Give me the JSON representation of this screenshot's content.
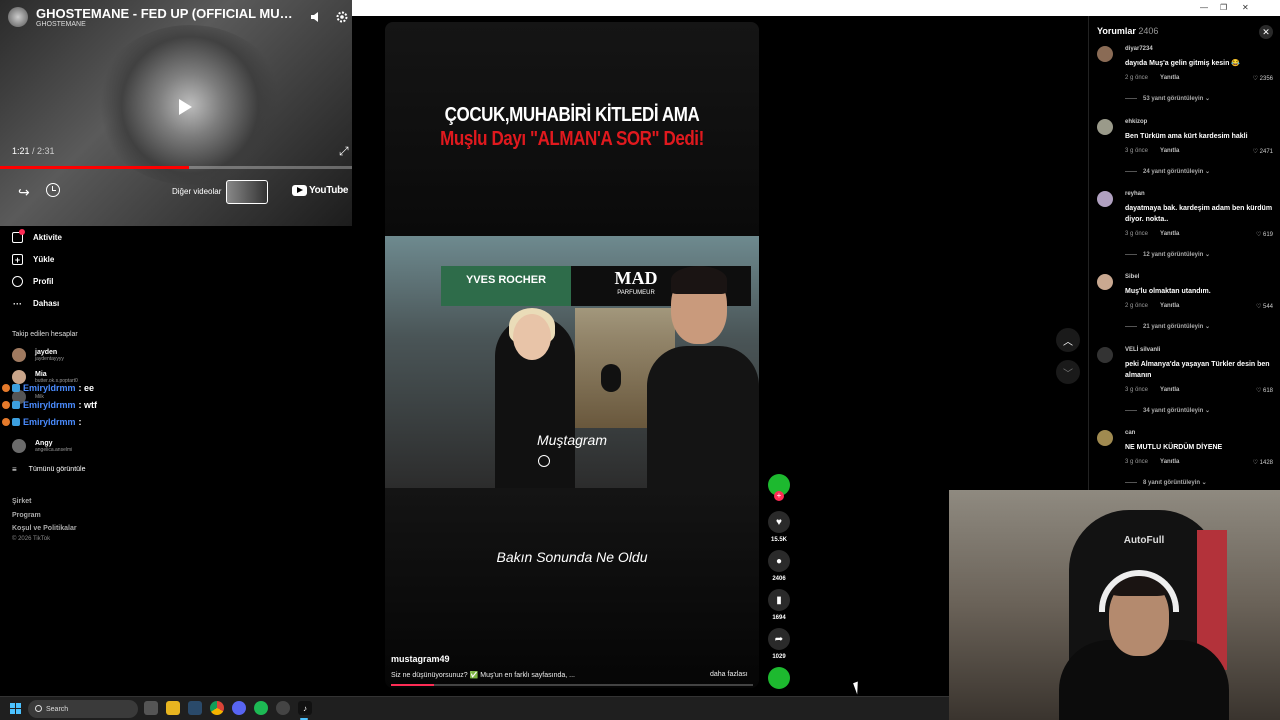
{
  "youtube_player": {
    "title": "GHOSTEMANE - FED UP (OFFICIAL MUSIC VIDEO)",
    "channel": "GHOSTEMANE",
    "current_time": "1:21",
    "duration": "/ 2:31",
    "progress": 0.536,
    "more_videos_label": "Diğer videolar",
    "logo_text": "YouTube"
  },
  "sidebar": {
    "nav": [
      {
        "label": "Aktivite",
        "icon": "inbox-icon"
      },
      {
        "label": "Yükle",
        "icon": "upload-icon"
      },
      {
        "label": "Profil",
        "icon": "profile-icon"
      },
      {
        "label": "Dahası",
        "icon": "more-icon"
      }
    ],
    "following_header": "Takip edilen hesaplar",
    "accounts": [
      {
        "name": "jayden",
        "handle": "jaydentayyyy"
      },
      {
        "name": "Mia",
        "handle": "butter.ok.s.poptart0"
      },
      {
        "name": "Milk",
        "handle": ""
      },
      {
        "name": "Angy",
        "handle": "angelica.anselmi"
      }
    ],
    "chat": [
      {
        "user": "Emiryldrmm",
        "text": ": ee"
      },
      {
        "user": "Emiryldrmm",
        "text": ": wtf"
      },
      {
        "user": "Emiryldrmm",
        "text": ":"
      }
    ],
    "show_all": "Tümünü görüntüle",
    "footer": [
      "Şirket",
      "Program",
      "Koşul ve Politikalar"
    ],
    "copyright": "© 2026 TikTok"
  },
  "video": {
    "headline_line1": "ÇOCUK,MUHABİRİ KİTLEDİ AMA",
    "headline_line2": "Muşlu Dayı \"ALMAN'A SOR\" Dedi!",
    "store_left": "YVES ROCHER",
    "store_right": "MAD",
    "store_right_sub": "PARFUMEUR",
    "watermark": "Muştagram",
    "bottom_caption": "Bakın Sonunda Ne Oldu",
    "author": "mustagram49",
    "description": "Siz ne düşünüyorsunuz? ✅ Muş'un en farklı sayfasında, ...",
    "more_label": "daha fazlası",
    "progress": 0.12
  },
  "actions": {
    "likes": "15.5K",
    "comments": "2406",
    "saves": "1694",
    "shares": "1029"
  },
  "comments_panel": {
    "title": "Yorumlar",
    "count": "2406",
    "reply_label": "Yanıtla",
    "items": [
      {
        "user": "diyar7234",
        "text": "dayıda Muş'a gelin gitmiş kesin 😂",
        "time": "2 g önce",
        "likes": "2356",
        "replies": "53 yanıt görüntüleyin"
      },
      {
        "user": "ehkizop",
        "text": "Ben Türküm ama kürt kardesim hakli",
        "time": "3 g önce",
        "likes": "2471",
        "replies": "24 yanıt görüntüleyin"
      },
      {
        "user": "reyhan",
        "text": "dayatmaya bak. kardeşim adam ben kürdüm diyor. nokta..",
        "time": "3 g önce",
        "likes": "619",
        "replies": "12 yanıt görüntüleyin"
      },
      {
        "user": "Sibel",
        "text": "Muş'lu olmaktan utandım.",
        "time": "2 g önce",
        "likes": "544",
        "replies": "21 yanıt görüntüleyin"
      },
      {
        "user": "VELİ silvanli",
        "text": "peki Almanya'da yaşayan Türkler desin ben almanın",
        "time": "3 g önce",
        "likes": "618",
        "replies": "34 yanıt görüntüleyin"
      },
      {
        "user": "can",
        "text": "NE MUTLU KÜRDÜM DİYENE",
        "time": "3 g önce",
        "likes": "1428",
        "replies": "8 yanıt görüntüleyin"
      }
    ]
  },
  "webcam": {
    "chair_text": "AutoFull"
  },
  "taskbar": {
    "search_placeholder": "Search"
  },
  "colors": {
    "tiktok_red": "#fe2c55",
    "yt_red": "#ff0000",
    "accent_blue": "#4cc2ff"
  }
}
